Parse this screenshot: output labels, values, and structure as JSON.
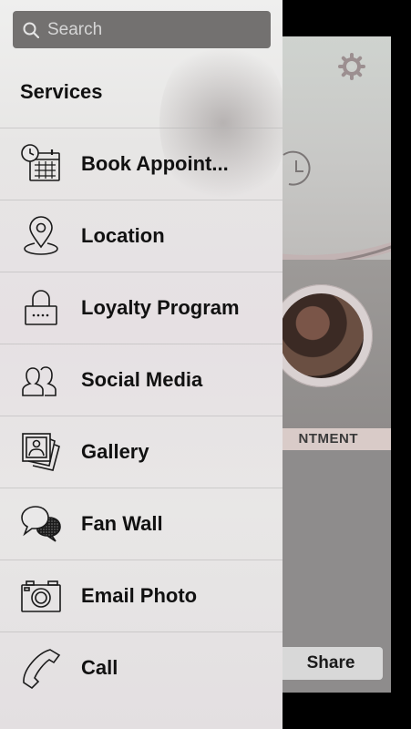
{
  "search": {
    "placeholder": "Search"
  },
  "drawer": {
    "section_title": "Services",
    "items": [
      {
        "label": "Book Appoint...",
        "icon": "calendar-clock-icon"
      },
      {
        "label": "Location",
        "icon": "location-pin-icon"
      },
      {
        "label": "Loyalty Program",
        "icon": "lock-icon"
      },
      {
        "label": "Social Media",
        "icon": "people-icon"
      },
      {
        "label": "Gallery",
        "icon": "photo-gallery-icon"
      },
      {
        "label": "Fan Wall",
        "icon": "speech-bubbles-icon"
      },
      {
        "label": "Email Photo",
        "icon": "camera-icon"
      },
      {
        "label": "Call",
        "icon": "phone-icon"
      }
    ]
  },
  "background_app": {
    "appointment_band": "NTMENT",
    "share_label": "Share",
    "gear_icon": "gear-icon"
  },
  "colors": {
    "search_bg": "#737170",
    "text": "#111111",
    "accent_band": "#d9cbc8"
  }
}
